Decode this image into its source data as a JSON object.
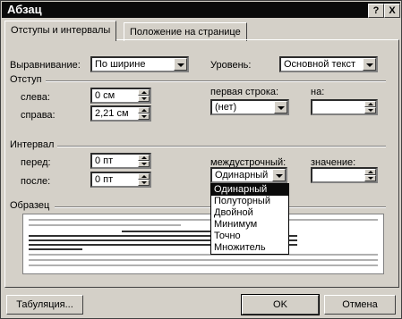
{
  "window": {
    "title": "Абзац",
    "help_button": "?",
    "close_button": "X"
  },
  "tabs": [
    {
      "label": "Отступы и интервалы",
      "active": true
    },
    {
      "label": "Положение на странице",
      "active": false
    }
  ],
  "alignment": {
    "label": "Выравнивание:",
    "value": "По ширине"
  },
  "level": {
    "label": "Уровень:",
    "value": "Основной текст"
  },
  "indent": {
    "section_label": "Отступ",
    "left_label": "слева:",
    "left_value": "0 см",
    "right_label": "справа:",
    "right_value": "2,21 см",
    "first_line_label": "первая строка:",
    "first_line_value": "(нет)",
    "by_label": "на:",
    "by_value": ""
  },
  "spacing": {
    "section_label": "Интервал",
    "before_label": "перед:",
    "before_value": "0 пт",
    "after_label": "после:",
    "after_value": "0 пт",
    "line_spacing_label": "междустрочный:",
    "line_spacing_value": "Одинарный",
    "at_label": "значение:",
    "at_value": "",
    "line_spacing_options": [
      "Одинарный",
      "Полуторный",
      "Двойной",
      "Минимум",
      "Точно",
      "Множитель"
    ],
    "selected_index": 0
  },
  "preview": {
    "section_label": "Образец"
  },
  "buttons": {
    "tabs_label": "Табуляция...",
    "ok_label": "OK",
    "cancel_label": "Отмена"
  }
}
